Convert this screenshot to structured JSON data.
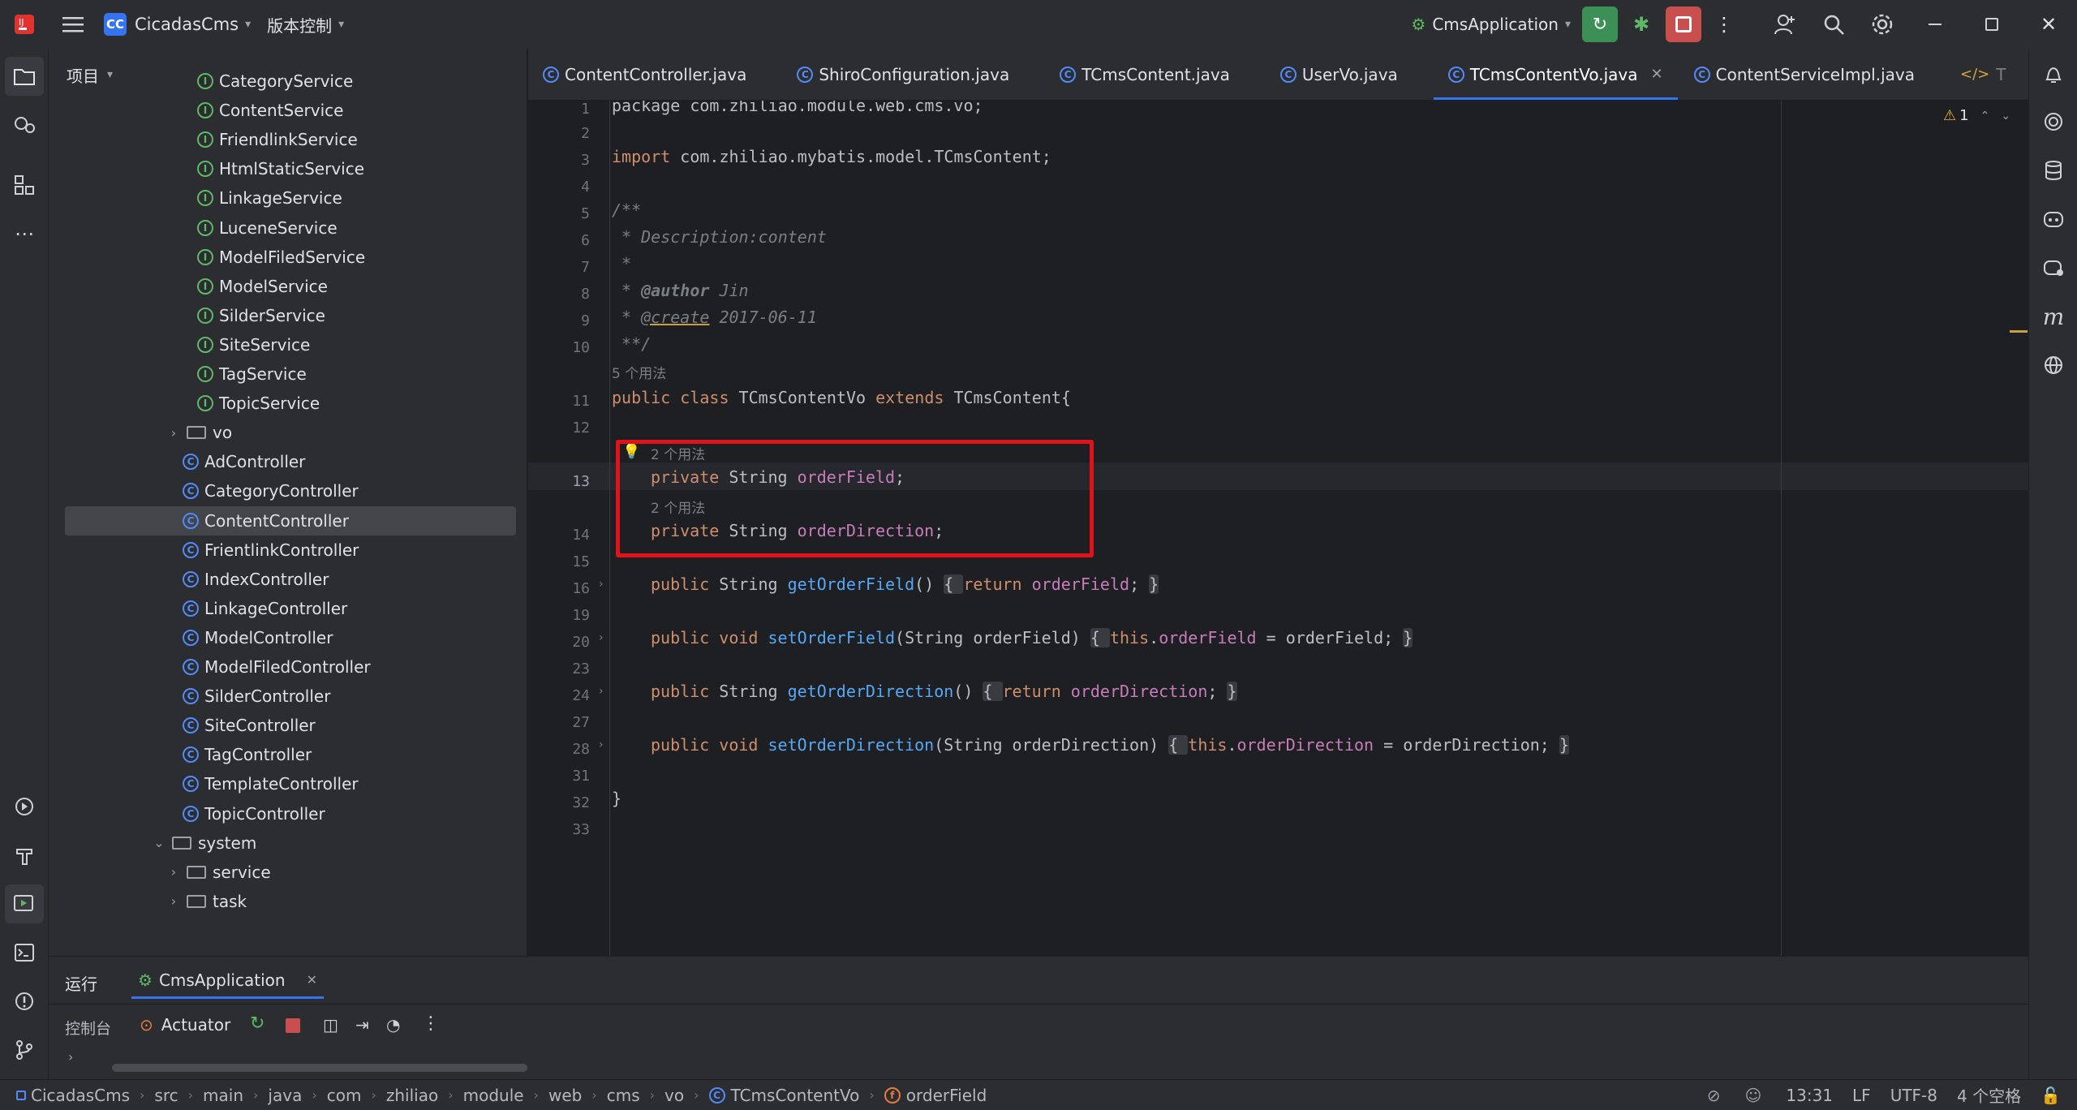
{
  "titlebar": {
    "project_badge": "CC",
    "project_name": "CicadasCms",
    "vcs": "版本控制",
    "run_config": "CmsApplication"
  },
  "project_panel": {
    "title": "项目",
    "items": [
      {
        "label": "CategoryService",
        "kind": "interface"
      },
      {
        "label": "ContentService",
        "kind": "interface"
      },
      {
        "label": "FriendlinkService",
        "kind": "interface"
      },
      {
        "label": "HtmlStaticService",
        "kind": "interface"
      },
      {
        "label": "LinkageService",
        "kind": "interface"
      },
      {
        "label": "LuceneService",
        "kind": "interface"
      },
      {
        "label": "ModelFiledService",
        "kind": "interface"
      },
      {
        "label": "ModelService",
        "kind": "interface"
      },
      {
        "label": "SilderService",
        "kind": "interface"
      },
      {
        "label": "SiteService",
        "kind": "interface"
      },
      {
        "label": "TagService",
        "kind": "interface"
      },
      {
        "label": "TopicService",
        "kind": "interface"
      },
      {
        "label": "vo",
        "kind": "folder"
      },
      {
        "label": "AdController",
        "kind": "class"
      },
      {
        "label": "CategoryController",
        "kind": "class"
      },
      {
        "label": "ContentController",
        "kind": "class",
        "selected": true
      },
      {
        "label": "FrientlinkController",
        "kind": "class"
      },
      {
        "label": "IndexController",
        "kind": "class"
      },
      {
        "label": "LinkageController",
        "kind": "class"
      },
      {
        "label": "ModelController",
        "kind": "class"
      },
      {
        "label": "ModelFiledController",
        "kind": "class"
      },
      {
        "label": "SilderController",
        "kind": "class"
      },
      {
        "label": "SiteController",
        "kind": "class"
      },
      {
        "label": "TagController",
        "kind": "class"
      },
      {
        "label": "TemplateController",
        "kind": "class"
      },
      {
        "label": "TopicController",
        "kind": "class"
      },
      {
        "label": "system",
        "kind": "folder-open"
      },
      {
        "label": "service",
        "kind": "folder"
      },
      {
        "label": "task",
        "kind": "folder"
      }
    ]
  },
  "tabs": [
    {
      "label": "ContentController.java"
    },
    {
      "label": "ShiroConfiguration.java"
    },
    {
      "label": "TCmsContent.java"
    },
    {
      "label": "UserVo.java"
    },
    {
      "label": "TCmsContentVo.java",
      "active": true
    },
    {
      "label": "ContentServiceImpl.java"
    },
    {
      "label": "T"
    }
  ],
  "editor": {
    "warning_count": "1",
    "line_numbers": [
      "1",
      "2",
      "3",
      "4",
      "5",
      "6",
      "7",
      "8",
      "9",
      "10",
      "11",
      "12",
      "13",
      "14",
      "15",
      "16",
      "19",
      "20",
      "23",
      "24",
      "27",
      "28",
      "31",
      "32",
      "33"
    ],
    "usage_hint_1": "5 个用法",
    "usage_hint_2": "2 个用法",
    "usage_hint_3": "2 个用法",
    "lines": {
      "l1": "package com.zhiliao.module.web.cms.vo;",
      "l3_kw": "import",
      "l3": " com.zhiliao.mybatis.model.TCmsContent;",
      "l5": "/**",
      "l6": " * Description:content",
      "l7": " *",
      "l8_a": " * ",
      "l8_tag": "@author",
      "l8_b": " Jin",
      "l9_a": " * ",
      "l9_tag": "@create",
      "l9_b": " 2017-06-11",
      "l10": " **/",
      "l11_kw": "public class",
      "l11_name": " TCmsContentVo ",
      "l11_ext": "extends",
      "l11_rest": " TCmsContent{",
      "l13_kw": "private",
      "l13_type": " String ",
      "l13_field": "orderField",
      "l14_kw": "private",
      "l14_type": " String ",
      "l14_field": "orderDirection",
      "l16_kw": "public",
      "l16_type": " String ",
      "l16_fn": "getOrderField",
      "l16_ret": "return",
      "l16_field": "orderField",
      "l20_kw": "public void",
      "l20_fn": "setOrderField",
      "l20_param": "(String orderField)",
      "l20_this": "this",
      "l20_field": "orderField",
      "l20_rest": " = orderField;",
      "l24_kw": "public",
      "l24_type": " String ",
      "l24_fn": "getOrderDirection",
      "l24_ret": "return",
      "l24_field": "orderDirection",
      "l28_kw": "public void",
      "l28_fn": "setOrderDirection",
      "l28_param": "(String orderDirection)",
      "l28_this": "this",
      "l28_field": "orderDirection",
      "l28_rest": " = orderDirection;",
      "l32": "}"
    }
  },
  "run_panel": {
    "tab_run": "运行",
    "tab_app": "CmsApplication",
    "console": "控制台",
    "actuator": "Actuator"
  },
  "statusbar": {
    "breadcrumb": [
      "CicadasCms",
      "src",
      "main",
      "java",
      "com",
      "zhiliao",
      "module",
      "web",
      "cms",
      "vo",
      "TCmsContentVo",
      "orderField"
    ],
    "position": "13:31",
    "line_sep": "LF",
    "encoding": "UTF-8",
    "indent": "4 个空格"
  },
  "colors": {
    "accent": "#3574f0",
    "highlight_box": "#e0131b",
    "run_green": "#3d8f58",
    "stop_red": "#c94f4f"
  }
}
